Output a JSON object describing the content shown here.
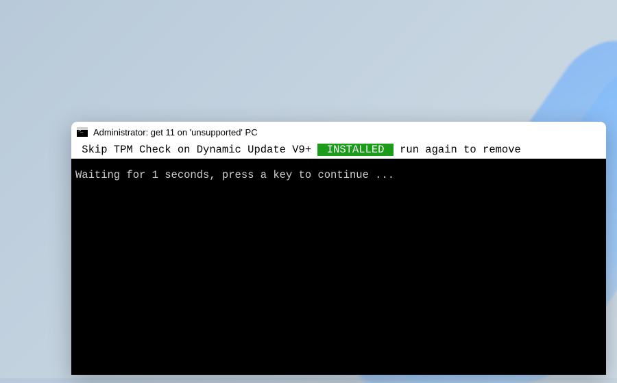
{
  "window": {
    "title": "Administrator:  get 11 on 'unsupported' PC"
  },
  "status": {
    "prefix": " Skip TPM Check on Dynamic Update V9+ ",
    "badge": " INSTALLED ",
    "suffix": " run again to remove "
  },
  "body": {
    "line1": "Waiting for 1 seconds, press a key to continue ..."
  }
}
